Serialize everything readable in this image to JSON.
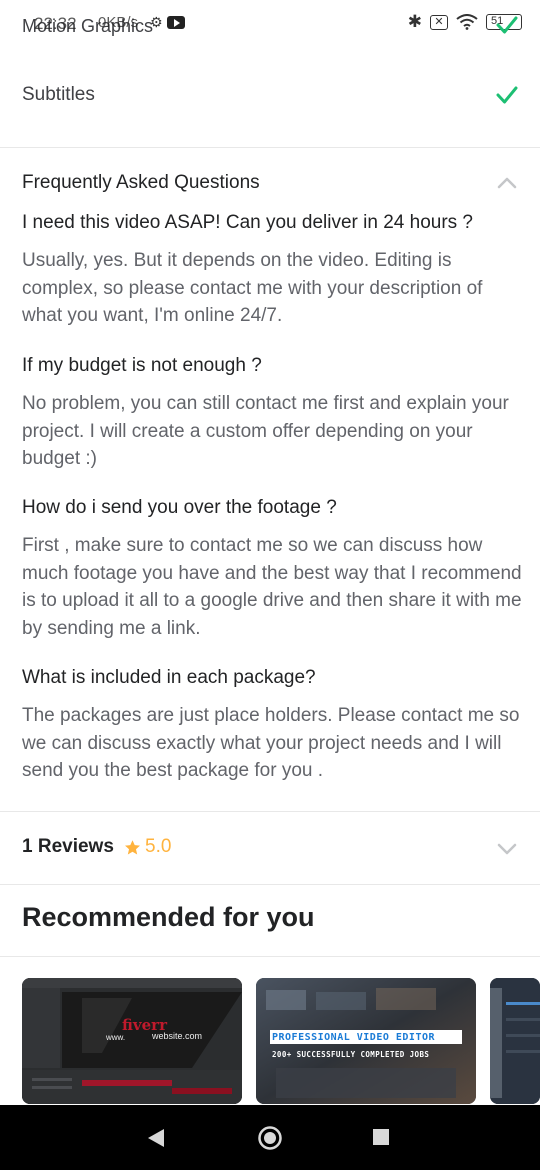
{
  "status_bar": {
    "overlap_text": "Motion Graphics",
    "time": "22:32",
    "speed": "0KB/s",
    "battery": "51"
  },
  "subtitles": {
    "label": "Subtitles"
  },
  "faq": {
    "title": "Frequently Asked Questions",
    "items": [
      {
        "question": "I need this video ASAP! Can you deliver in 24 hours ?",
        "answer": "Usually, yes. But it depends on the video. Editing is complex, so please contact me with your description of what you want, I'm online 24/7."
      },
      {
        "question": "If my budget is not enough ?",
        "answer": "No problem, you can still contact me first and explain your project. I will create a custom offer depending on your budget :)"
      },
      {
        "question": "How do i send you over the footage ?",
        "answer": "First , make sure to contact me so we can discuss how much footage you have and the best way that I recommend is to upload it all to a google drive and then share it with me by sending me a link."
      },
      {
        "question": "What is included in each package?",
        "answer": "The packages are just place holders. Please contact me so we can discuss exactly what your project needs and I will send you the best package for you ."
      }
    ]
  },
  "reviews": {
    "label": "1 Reviews",
    "rating": "5.0"
  },
  "recommended": {
    "title": "Recommended for you",
    "cards": [
      {
        "brand": "fiverr",
        "url_text": "www.",
        "url_suffix": "website.com"
      },
      {
        "headline": "PROFESSIONAL VIDEO EDITOR",
        "subline": "200+ SUCCESSFULLY COMPLETED JOBS"
      }
    ]
  },
  "colors": {
    "accent_green": "#1dbf73",
    "star": "#ffb33e",
    "chevron": "#c5c6c9"
  }
}
